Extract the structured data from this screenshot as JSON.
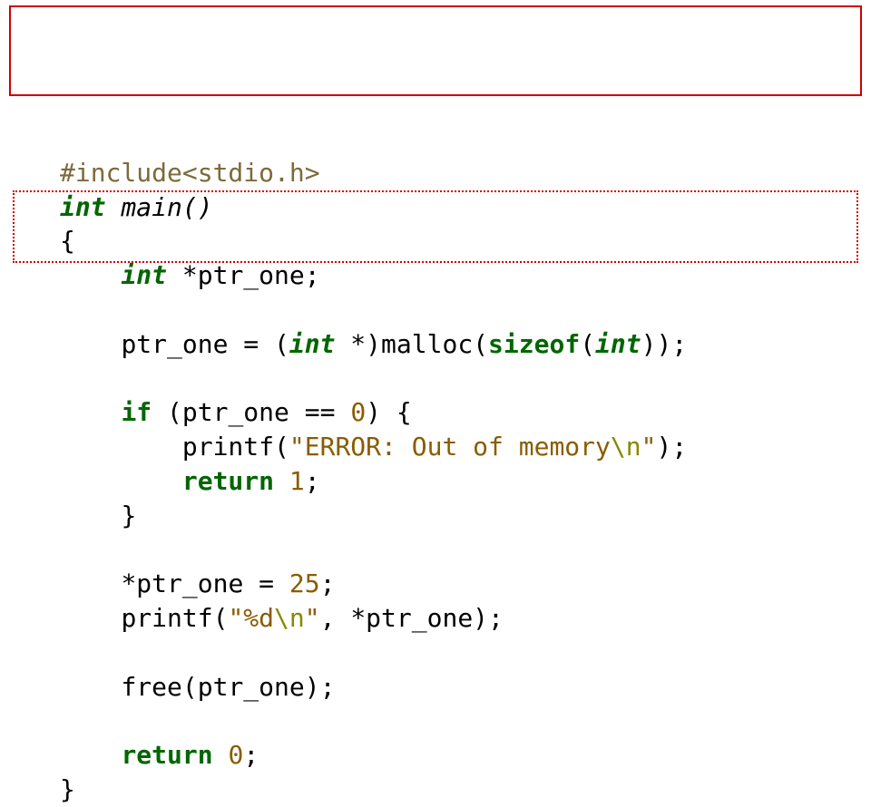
{
  "code": {
    "l1_preproc": "#include<stdio.h>",
    "l2_kw_int": "int",
    "l2_main": " main()",
    "l3_brace": "{",
    "l4_indent": "    ",
    "l4_kw_int": "int",
    "l4_rest": " *ptr_one;",
    "l5_indent": "    ",
    "l5_a": "ptr_one = (",
    "l5_kw_int": "int",
    "l5_b": " *)malloc(",
    "l5_kw_sizeof": "sizeof",
    "l5_c": "(",
    "l5_kw_int2": "int",
    "l5_d": "));",
    "l6_indent": "    ",
    "l6_kw_if": "if",
    "l6_a": " (ptr_one == ",
    "l6_num": "0",
    "l6_b": ") {",
    "l7_indent": "        ",
    "l7_a": "printf(",
    "l7_str_a": "\"ERROR: Out of memory",
    "l7_esc": "\\n",
    "l7_str_b": "\"",
    "l7_b": ");",
    "l8_indent": "        ",
    "l8_kw_return": "return",
    "l8_sp": " ",
    "l8_num": "1",
    "l8_semi": ";",
    "l9_indent": "    ",
    "l9_brace": "}",
    "l10_indent": "    ",
    "l10_a": "*ptr_one = ",
    "l10_num": "25",
    "l10_semi": ";",
    "l11_indent": "    ",
    "l11_a": "printf(",
    "l11_str_a": "\"%d",
    "l11_esc": "\\n",
    "l11_str_b": "\"",
    "l11_b": ", *ptr_one);",
    "l12_indent": "    ",
    "l12_a": "free(ptr_one);",
    "l13_indent": "    ",
    "l13_kw_return": "return",
    "l13_sp": " ",
    "l13_num": "0",
    "l13_semi": ";",
    "l14_brace": "}"
  }
}
